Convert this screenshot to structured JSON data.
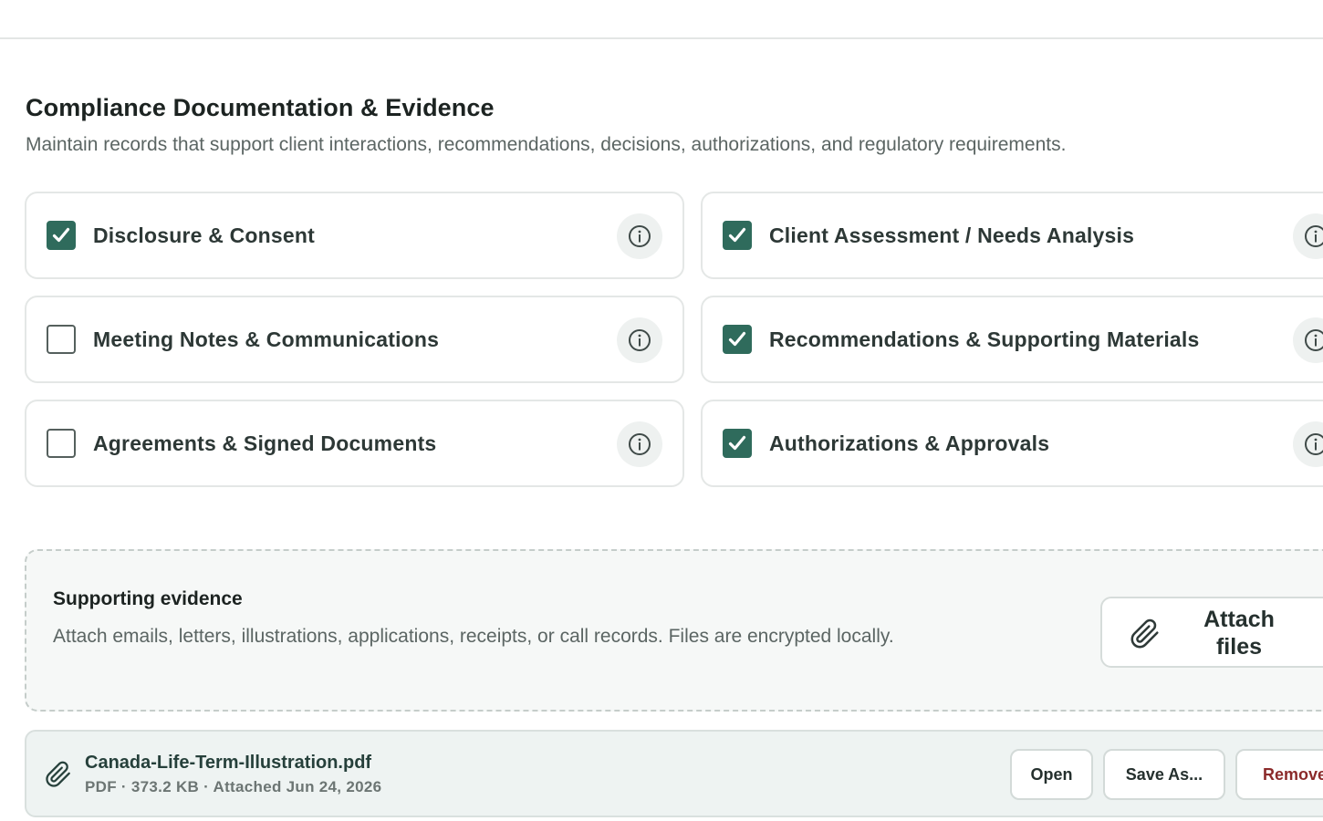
{
  "section": {
    "title": "Compliance Documentation & Evidence",
    "description": "Maintain records that support client interactions, recommendations, decisions, authorizations, and regulatory requirements."
  },
  "checklist": [
    {
      "label": "Disclosure & Consent",
      "checked": true
    },
    {
      "label": "Client Assessment / Needs Analysis",
      "checked": true
    },
    {
      "label": "Meeting Notes & Communications",
      "checked": false
    },
    {
      "label": "Recommendations & Supporting Materials",
      "checked": true
    },
    {
      "label": "Agreements & Signed Documents",
      "checked": false
    },
    {
      "label": "Authorizations & Approvals",
      "checked": true
    }
  ],
  "evidence": {
    "title": "Supporting evidence",
    "description": "Attach emails, letters, illustrations, applications, receipts, or call records. Files are encrypted locally.",
    "attach_label": "Attach files"
  },
  "attachment": {
    "file_name": "Canada-Life-Term-Illustration.pdf",
    "meta": "PDF · 373.2 KB · Attached Jun 24, 2026",
    "open_label": "Open",
    "save_as_label": "Save As...",
    "remove_label": "Remove"
  },
  "colors": {
    "accent": "#2f6b5c",
    "danger": "#8b2a2a",
    "muted_text": "#5b6563"
  },
  "icons": {
    "info": "info-circle-icon",
    "attach": "paperclip-icon",
    "check": "checkmark-icon"
  }
}
